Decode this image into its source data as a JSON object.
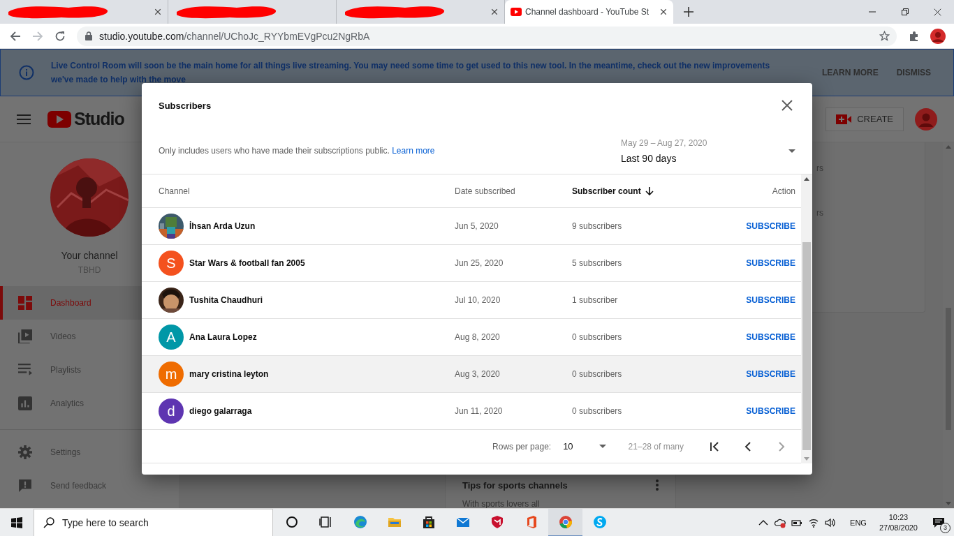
{
  "browser": {
    "tabs": [
      {
        "redacted": true,
        "closable": true,
        "selected": false
      },
      {
        "redacted": true,
        "closable": false,
        "selected": false
      },
      {
        "redacted": true,
        "closable": true,
        "selected": false
      },
      {
        "redacted": false,
        "title": "Channel dashboard - YouTube St",
        "closable": true,
        "selected": true
      }
    ],
    "forward_disabled": true,
    "url_host": "studio.youtube.com",
    "url_path": "/channel/UChoJc_RYYbmEVgPcu2NgRbA"
  },
  "banner": {
    "message": "Live Control Room will soon be the main home for all things live streaming. You may need some time to get used to this new tool. In the meantime, check out the new improvements we've made to help with the move",
    "actions": [
      "LEARN MORE",
      "DISMISS"
    ]
  },
  "header": {
    "logo_text": "Studio",
    "create_label": "CREATE"
  },
  "sidebar": {
    "channel_label": "Your channel",
    "channel_name": "TBHD",
    "items": [
      {
        "label": "Dashboard",
        "selected": true
      },
      {
        "label": "Videos",
        "selected": false
      },
      {
        "label": "Playlists",
        "selected": false
      },
      {
        "label": "Analytics",
        "selected": false
      }
    ],
    "footer_items": [
      {
        "label": "Settings"
      },
      {
        "label": "Send feedback"
      }
    ]
  },
  "background": {
    "card_fragments": [
      "rs",
      "rs"
    ],
    "tips_title": "Tips for sports channels",
    "tips_text": "With sports lovers all"
  },
  "dialog": {
    "title": "Subscribers",
    "note": "Only includes users who have made their subscriptions public.",
    "note_link": "Learn more",
    "date_range": {
      "dates": "May 29 – Aug 27, 2020",
      "label": "Last 90 days"
    },
    "columns": [
      {
        "label": "Channel",
        "sorted": false
      },
      {
        "label": "Date subscribed",
        "sorted": false
      },
      {
        "label": "Subscriber count",
        "sorted": true
      },
      {
        "label": "Action",
        "sorted": false
      }
    ],
    "rows": [
      {
        "name": "İhsan Arda Uzun",
        "date": "Jun 5, 2020",
        "count": "9 subscribers",
        "action": "SUBSCRIBE",
        "hovered": false
      },
      {
        "avatar": {
          "kind": "letter",
          "letter": "S",
          "color": "#f4511e"
        },
        "name": "Star Wars & football fan 2005",
        "date": "Jun 25, 2020",
        "count": "5 subscribers",
        "action": "SUBSCRIBE",
        "hovered": false
      },
      {
        "name": "Tushita Chaudhuri",
        "date": "Jul 10, 2020",
        "count": "1 subscriber",
        "action": "SUBSCRIBE",
        "hovered": false
      },
      {
        "avatar": {
          "kind": "letter",
          "letter": "A",
          "color": "#0097a7"
        },
        "name": "Ana Laura Lopez",
        "date": "Aug 8, 2020",
        "count": "0 subscribers",
        "action": "SUBSCRIBE",
        "hovered": false
      },
      {
        "avatar": {
          "kind": "letter",
          "letter": "m",
          "color": "#ef6c00"
        },
        "name": "mary cristina leyton",
        "date": "Aug 3, 2020",
        "count": "0 subscribers",
        "action": "SUBSCRIBE",
        "hovered": true
      },
      {
        "avatar": {
          "kind": "letter",
          "letter": "d",
          "color": "#5e35b1"
        },
        "name": "diego galarraga",
        "date": "Jun 11, 2020",
        "count": "0 subscribers",
        "action": "SUBSCRIBE",
        "hovered": false
      }
    ],
    "pagination": {
      "rows_label": "Rows per page:",
      "rows_value": "10",
      "range": "21–28 of many",
      "first_disabled": false,
      "prev_disabled": false,
      "next_disabled": true
    }
  },
  "taskbar": {
    "search_placeholder": "Type here to search",
    "apps": [
      {
        "active": false
      },
      {
        "active": false
      },
      {
        "active": false
      },
      {
        "active": false
      },
      {
        "active": false
      },
      {
        "active": false
      },
      {
        "active": false
      },
      {
        "active": false
      },
      {
        "active": true
      },
      {
        "active": false
      }
    ],
    "language": "ENG",
    "time": "10:23",
    "date": "27/08/2020",
    "notifications": "3"
  }
}
